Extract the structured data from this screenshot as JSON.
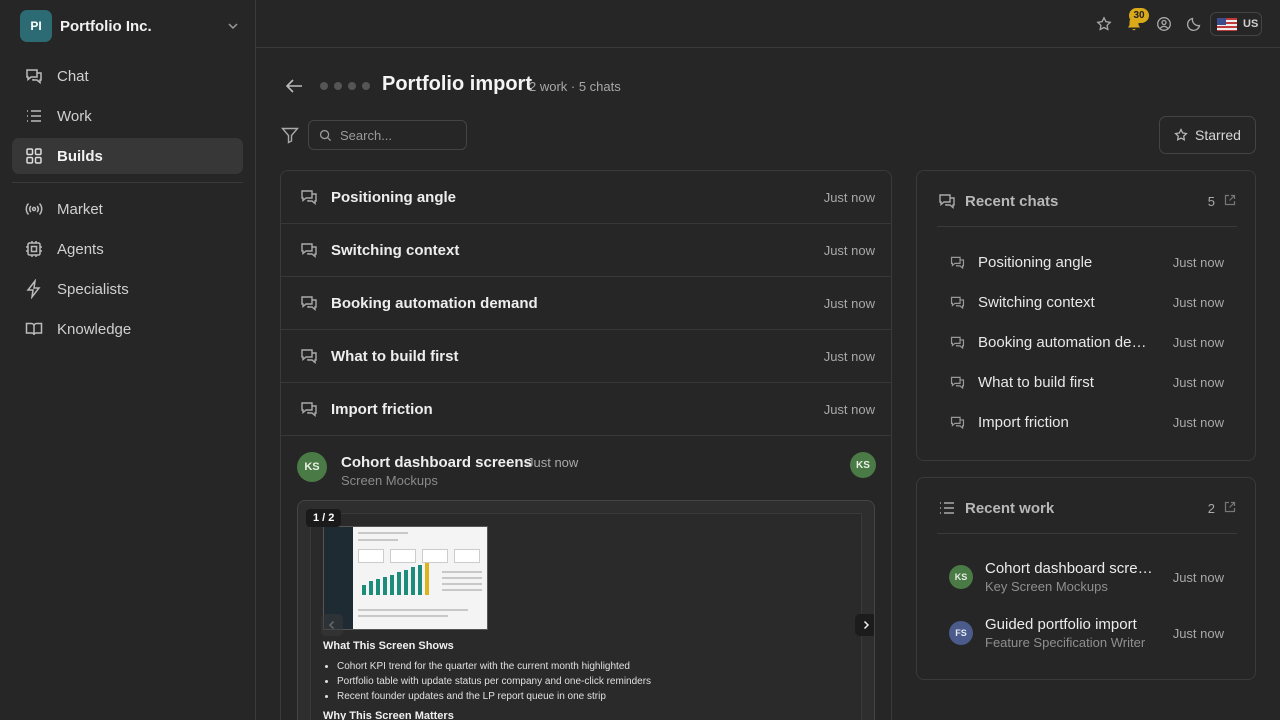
{
  "org": {
    "initials": "PI",
    "name": "Portfolio Inc.",
    "logo_color": "#2c6b73"
  },
  "sidebar": {
    "primary": [
      {
        "label": "Chat",
        "icon": "chat-icon"
      },
      {
        "label": "Work",
        "icon": "list-icon"
      },
      {
        "label": "Builds",
        "icon": "grid-icon",
        "active": true
      }
    ],
    "secondary": [
      {
        "label": "Market",
        "icon": "broadcast-icon"
      },
      {
        "label": "Agents",
        "icon": "chip-icon"
      },
      {
        "label": "Specialists",
        "icon": "bolt-icon"
      },
      {
        "label": "Knowledge",
        "icon": "book-icon"
      }
    ]
  },
  "topbar": {
    "notification_count": "30",
    "locale": "US",
    "accent": "#d9a91a"
  },
  "header": {
    "title": "Portfolio import",
    "meta": "2 work · 5 chats"
  },
  "toolbar": {
    "search_placeholder": "Search...",
    "starred_label": "Starred"
  },
  "main": {
    "chats": [
      {
        "title": "Positioning angle",
        "time": "Just now"
      },
      {
        "title": "Switching context",
        "time": "Just now"
      },
      {
        "title": "Booking automation demand",
        "time": "Just now"
      },
      {
        "title": "What to build first",
        "time": "Just now"
      },
      {
        "title": "Import friction",
        "time": "Just now"
      }
    ],
    "work_item": {
      "initials": "KS",
      "title": "Cohort dashboard screens",
      "time": "Just now",
      "subtitle": "Screen Mockups",
      "page_count": "1 / 2",
      "preview_heading": "What This Screen Shows",
      "preview_bullets": [
        "Cohort KPI trend for the quarter with the current month highlighted",
        "Portfolio table with update status per company and one-click reminders",
        "Recent founder updates and the LP report queue in one strip"
      ],
      "preview_heading_2": "Why This Screen Matters"
    }
  },
  "recent_chats": {
    "title": "Recent chats",
    "count": "5",
    "items": [
      {
        "title": "Positioning angle",
        "time": "Just now"
      },
      {
        "title": "Switching context",
        "time": "Just now"
      },
      {
        "title": "Booking automation demand",
        "time": "Just now"
      },
      {
        "title": "What to build first",
        "time": "Just now"
      },
      {
        "title": "Import friction",
        "time": "Just now"
      }
    ]
  },
  "recent_work": {
    "title": "Recent work",
    "count": "2",
    "items": [
      {
        "initials": "KS",
        "title": "Cohort dashboard screens",
        "subtitle": "Key Screen Mockups",
        "time": "Just now",
        "color": "#4a7a45"
      },
      {
        "initials": "FS",
        "title": "Guided portfolio import",
        "subtitle": "Feature Specification Writer",
        "time": "Just now",
        "color": "#4a5b8c"
      }
    ]
  }
}
